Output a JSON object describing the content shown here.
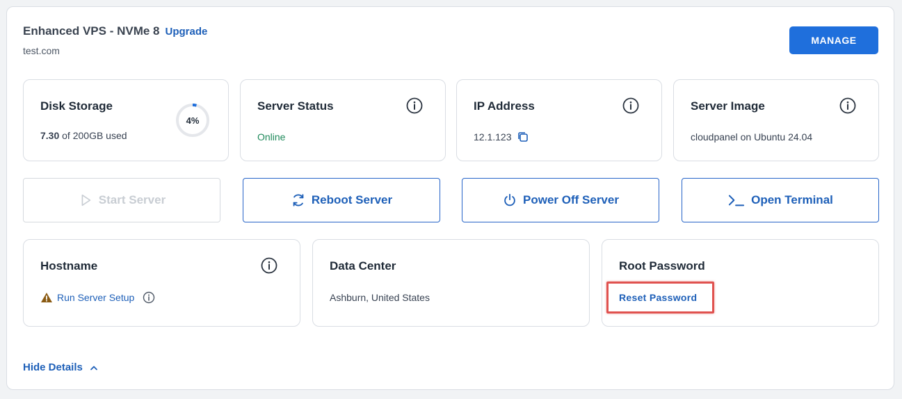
{
  "header": {
    "plan_title": "Enhanced VPS - NVMe 8",
    "upgrade_label": "Upgrade",
    "domain": "test.com",
    "manage_label": "MANAGE"
  },
  "disk": {
    "title": "Disk Storage",
    "used_value": "7.30",
    "used_suffix": " of 200GB used",
    "percent_label": "4%",
    "percent": 4
  },
  "status": {
    "title": "Server Status",
    "value": "Online"
  },
  "ip": {
    "title": "IP Address",
    "value": "12.1.123"
  },
  "image": {
    "title": "Server Image",
    "value": "cloudpanel on Ubuntu 24.04"
  },
  "actions": {
    "start": "Start Server",
    "reboot": "Reboot Server",
    "poweroff": "Power Off Server",
    "terminal": "Open Terminal"
  },
  "hostname": {
    "title": "Hostname",
    "setup_link": "Run Server Setup"
  },
  "datacenter": {
    "title": "Data Center",
    "value": "Ashburn, United States"
  },
  "root_password": {
    "title": "Root Password",
    "reset_link": "Reset Password"
  },
  "footer": {
    "hide_details": "Hide Details"
  },
  "colors": {
    "accent": "#1f6fdc",
    "link": "#1d5fb8",
    "online": "#1f8a5b",
    "warning": "#8a5a12",
    "highlight": "#e0524f"
  }
}
